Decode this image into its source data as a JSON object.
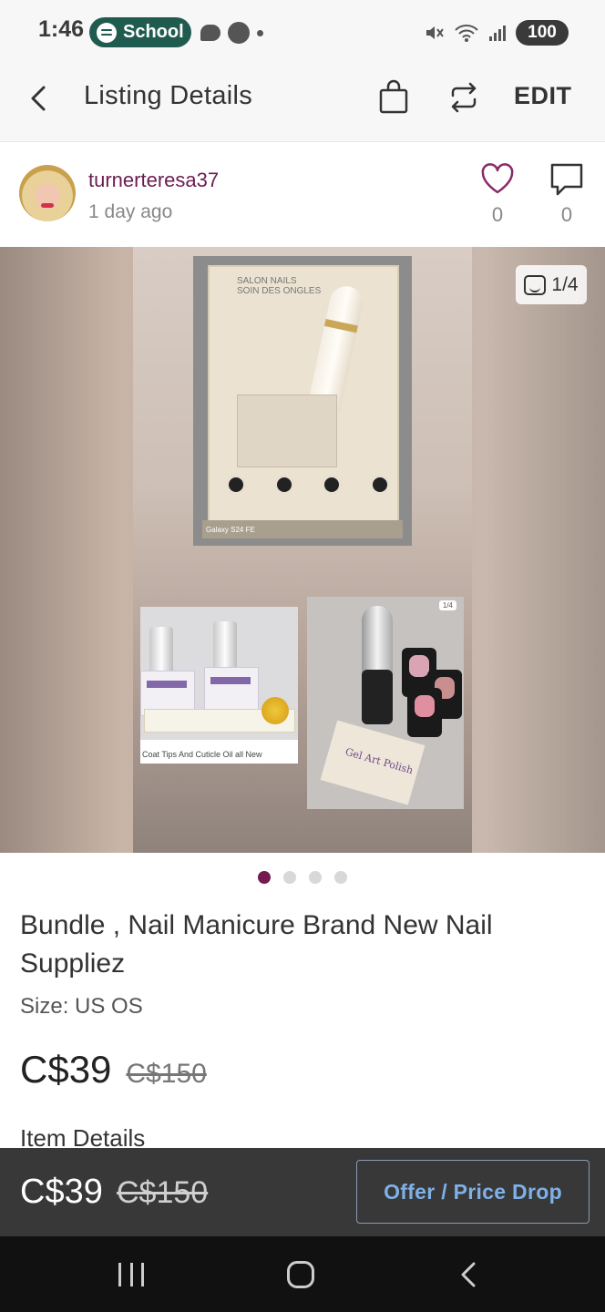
{
  "status_bar": {
    "time": "1:46",
    "pill_label": "School",
    "battery": "100"
  },
  "header": {
    "title": "Listing Details",
    "edit_label": "EDIT"
  },
  "seller": {
    "username": "turnerteresa37",
    "posted": "1 day ago",
    "likes": "0",
    "comments": "0"
  },
  "carousel": {
    "counter": "1/4",
    "main_photo_text": "SALON NAILS\nSOIN DES ONGLES",
    "watermark": "Galaxy S24 FE",
    "left_photo_caption": "Coat Tips And Cuticle Oil all New",
    "right_photo_card": "Gel Art Polish",
    "right_photo_counter": "1/4",
    "dots_total": 4,
    "active_index": 0
  },
  "listing": {
    "title": "Bundle , Nail Manicure Brand New Nail Suppliez",
    "size": "Size: US OS",
    "price": "C$39",
    "original_price": "C$150",
    "section_heading": "Item Details"
  },
  "action_bar": {
    "price": "C$39",
    "original_price": "C$150",
    "offer_label": "Offer / Price Drop"
  },
  "colors": {
    "accent": "#731a51",
    "offer_text": "#7fb0e6",
    "action_bar_bg": "#383838"
  },
  "icons": [
    "back-arrow-icon",
    "shopping-bag-icon",
    "repost-icon",
    "heart-icon",
    "comment-icon",
    "image-icon",
    "recents-icon",
    "home-icon",
    "nav-back-icon"
  ]
}
